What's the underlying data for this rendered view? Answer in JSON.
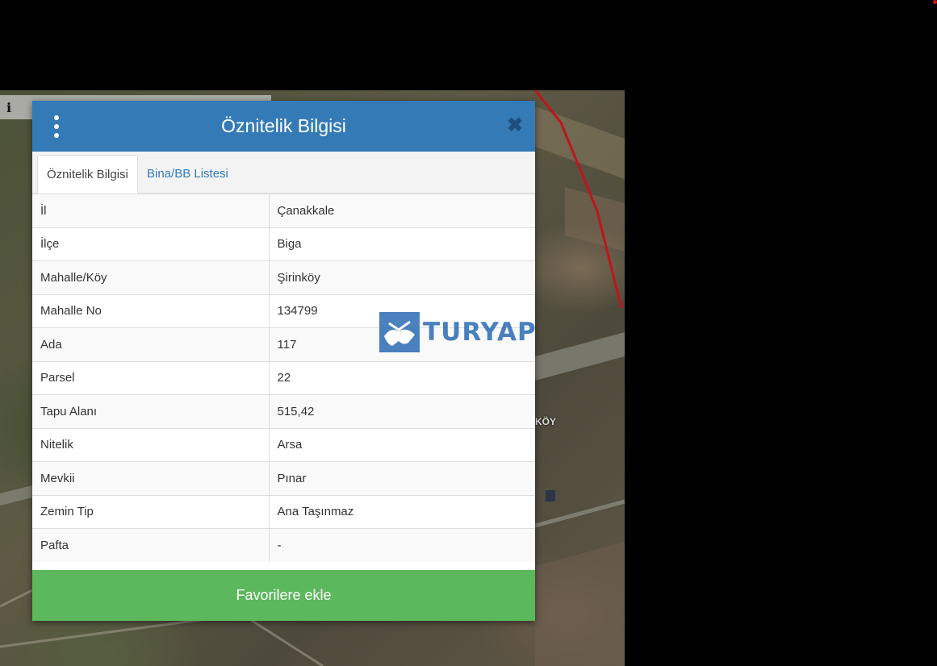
{
  "map": {
    "info_icon": "info-icon",
    "village_label": "KÖY"
  },
  "dialog": {
    "title": "Öznitelik Bilgisi",
    "menu_icon": "kebab-menu-icon",
    "close_icon": "close-icon",
    "close_symbol": "✖",
    "tabs": [
      {
        "label": "Öznitelik Bilgisi",
        "active": true
      },
      {
        "label": "Bina/BB Listesi",
        "active": false
      }
    ],
    "rows": [
      {
        "key": "İl",
        "value": "Çanakkale"
      },
      {
        "key": "İlçe",
        "value": "Biga"
      },
      {
        "key": "Mahalle/Köy",
        "value": "Şirinköy"
      },
      {
        "key": "Mahalle No",
        "value": "134799"
      },
      {
        "key": "Ada",
        "value": "117"
      },
      {
        "key": "Parsel",
        "value": "22"
      },
      {
        "key": "Tapu Alanı",
        "value": "515,42"
      },
      {
        "key": "Nitelik",
        "value": "Arsa"
      },
      {
        "key": "Mevkii",
        "value": "Pınar"
      },
      {
        "key": "Zemin Tip",
        "value": "Ana Taşınmaz"
      },
      {
        "key": "Pafta",
        "value": "-"
      }
    ],
    "favorite_button": "Favorilere ekle"
  },
  "watermark": {
    "text": "TURYAP",
    "icon": "handshake-logo-icon"
  },
  "colors": {
    "header": "#337ab7",
    "favorite_button": "#5cb85c",
    "parcel_boundary": "#c0141c"
  }
}
